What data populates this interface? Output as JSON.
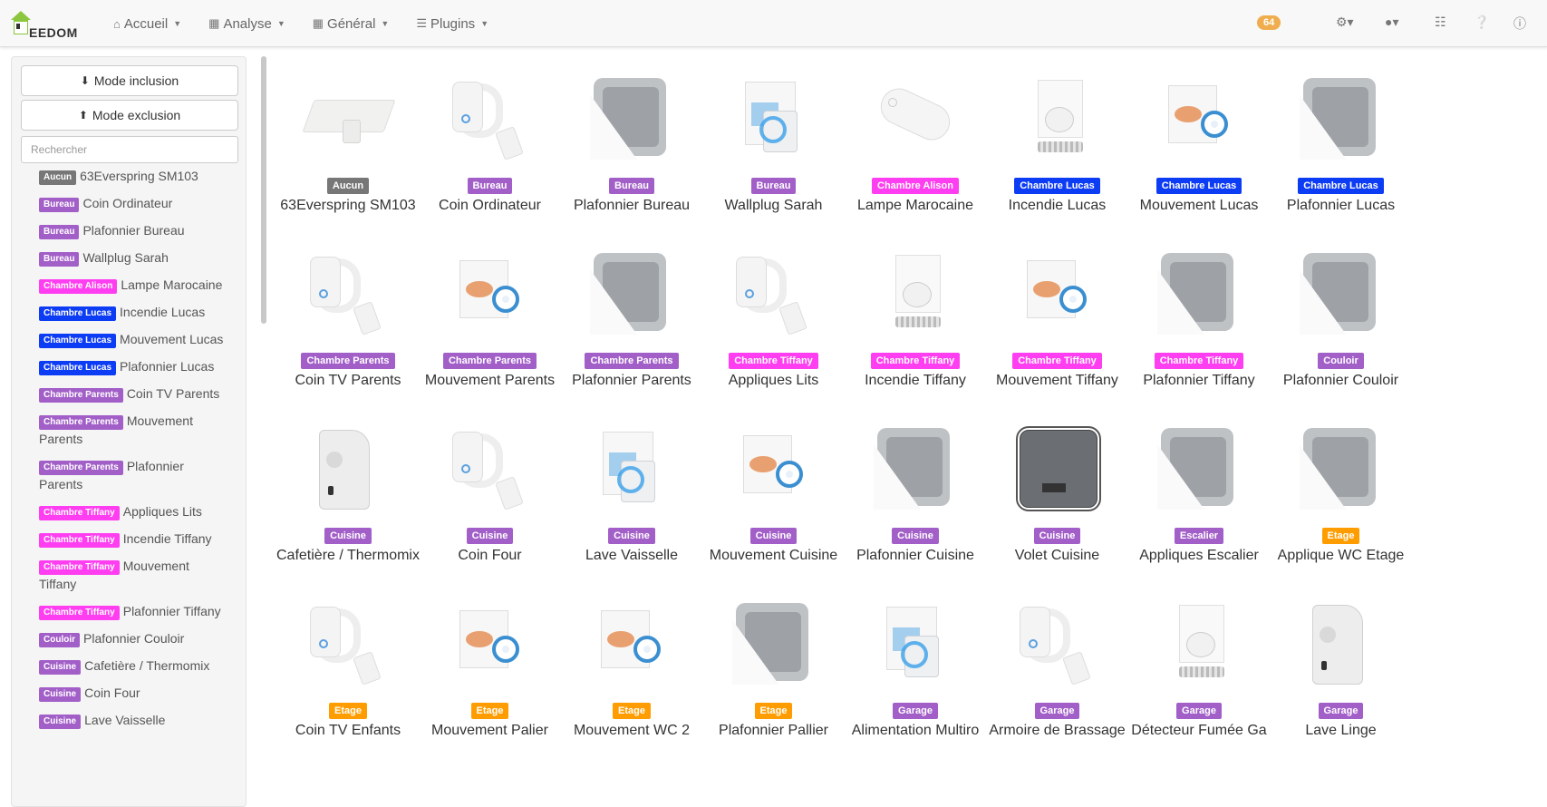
{
  "navbar": {
    "brand": "EEDOM",
    "menu": [
      {
        "label": "Accueil",
        "icon": "home-icon"
      },
      {
        "label": "Analyse",
        "icon": "grid-icon"
      },
      {
        "label": "Général",
        "icon": "grid-icon"
      },
      {
        "label": "Plugins",
        "icon": "list-icon"
      }
    ],
    "notification_count": "64",
    "right_icons": [
      "gears-icon",
      "user-icon",
      "sitemap-icon",
      "question-icon",
      "info-icon"
    ]
  },
  "sidebar": {
    "inclusion_label": "Mode inclusion",
    "exclusion_label": "Mode exclusion",
    "search_placeholder": "Rechercher",
    "items": [
      {
        "room": "Aucun",
        "name": "63Everspring SM103"
      },
      {
        "room": "Bureau",
        "name": "Coin Ordinateur"
      },
      {
        "room": "Bureau",
        "name": "Plafonnier Bureau"
      },
      {
        "room": "Bureau",
        "name": "Wallplug Sarah"
      },
      {
        "room": "Chambre Alison",
        "name": "Lampe Marocaine"
      },
      {
        "room": "Chambre Lucas",
        "name": "Incendie Lucas"
      },
      {
        "room": "Chambre Lucas",
        "name": "Mouvement Lucas"
      },
      {
        "room": "Chambre Lucas",
        "name": "Plafonnier Lucas"
      },
      {
        "room": "Chambre Parents",
        "name": "Coin TV Parents"
      },
      {
        "room": "Chambre Parents",
        "name": "Mouvement Parents"
      },
      {
        "room": "Chambre Parents",
        "name": "Plafonnier Parents"
      },
      {
        "room": "Chambre Tiffany",
        "name": "Appliques Lits"
      },
      {
        "room": "Chambre Tiffany",
        "name": "Incendie Tiffany"
      },
      {
        "room": "Chambre Tiffany",
        "name": "Mouvement Tiffany"
      },
      {
        "room": "Chambre Tiffany",
        "name": "Plafonnier Tiffany"
      },
      {
        "room": "Couloir",
        "name": "Plafonnier Couloir"
      },
      {
        "room": "Cuisine",
        "name": "Cafetière / Thermomix"
      },
      {
        "room": "Cuisine",
        "name": "Coin Four"
      },
      {
        "room": "Cuisine",
        "name": "Lave Vaisselle"
      }
    ]
  },
  "room_colors": {
    "Aucun": "#777777",
    "Bureau": "#a25fc8",
    "Chambre Alison": "#ff3df1",
    "Chambre Lucas": "#0d3cf5",
    "Chambre Parents": "#a25fc8",
    "Chambre Tiffany": "#ff3df1",
    "Couloir": "#a25fc8",
    "Cuisine": "#a25fc8",
    "Escalier": "#a25fc8",
    "Etage": "#ff9d00",
    "Garage": "#a25fc8"
  },
  "devices": [
    {
      "room": "Aucun",
      "name": "63Everspring SM103",
      "icon": "door-sensor-icon"
    },
    {
      "room": "Bureau",
      "name": "Coin Ordinateur",
      "icon": "plug-icon"
    },
    {
      "room": "Bureau",
      "name": "Plafonnier Bureau",
      "icon": "wall-switch-icon"
    },
    {
      "room": "Bureau",
      "name": "Wallplug Sarah",
      "icon": "wallplug-icon"
    },
    {
      "room": "Chambre Alison",
      "name": "Lampe Marocaine",
      "icon": "oval-module-icon"
    },
    {
      "room": "Chambre Lucas",
      "name": "Incendie Lucas",
      "icon": "smoke-sensor-icon"
    },
    {
      "room": "Chambre Lucas",
      "name": "Mouvement Lucas",
      "icon": "motion-sensor-icon"
    },
    {
      "room": "Chambre Lucas",
      "name": "Plafonnier Lucas",
      "icon": "wall-switch-icon"
    },
    {
      "room": "Chambre Parents",
      "name": "Coin TV Parents",
      "icon": "plug-icon"
    },
    {
      "room": "Chambre Parents",
      "name": "Mouvement Parents",
      "icon": "motion-sensor-icon"
    },
    {
      "room": "Chambre Parents",
      "name": "Plafonnier Parents",
      "icon": "wall-switch-icon"
    },
    {
      "room": "Chambre Tiffany",
      "name": "Appliques Lits",
      "icon": "plug-icon"
    },
    {
      "room": "Chambre Tiffany",
      "name": "Incendie Tiffany",
      "icon": "smoke-sensor-icon"
    },
    {
      "room": "Chambre Tiffany",
      "name": "Mouvement Tiffany",
      "icon": "motion-sensor-icon"
    },
    {
      "room": "Chambre Tiffany",
      "name": "Plafonnier Tiffany",
      "icon": "wall-switch-icon"
    },
    {
      "room": "Couloir",
      "name": "Plafonnier Couloir",
      "icon": "wall-switch-icon"
    },
    {
      "room": "Cuisine",
      "name": "Cafetière / Thermomix",
      "icon": "wall-plug-adapter-icon"
    },
    {
      "room": "Cuisine",
      "name": "Coin Four",
      "icon": "plug-icon"
    },
    {
      "room": "Cuisine",
      "name": "Lave Vaisselle",
      "icon": "wallplug-icon"
    },
    {
      "room": "Cuisine",
      "name": "Mouvement Cuisine",
      "icon": "motion-sensor-icon"
    },
    {
      "room": "Cuisine",
      "name": "Plafonnier Cuisine",
      "icon": "wall-switch-icon"
    },
    {
      "room": "Cuisine",
      "name": "Volet Cuisine",
      "icon": "shutter-module-icon"
    },
    {
      "room": "Escalier",
      "name": "Appliques Escalier",
      "icon": "wall-switch-icon"
    },
    {
      "room": "Etage",
      "name": "Applique WC Etage",
      "icon": "wall-switch-icon"
    },
    {
      "room": "Etage",
      "name": "Coin TV Enfants",
      "icon": "plug-icon"
    },
    {
      "room": "Etage",
      "name": "Mouvement Palier",
      "icon": "motion-sensor-icon"
    },
    {
      "room": "Etage",
      "name": "Mouvement WC 2",
      "icon": "motion-sensor-icon"
    },
    {
      "room": "Etage",
      "name": "Plafonnier Pallier",
      "icon": "wall-switch-icon"
    },
    {
      "room": "Garage",
      "name": "Alimentation Multiro",
      "icon": "wallplug-icon"
    },
    {
      "room": "Garage",
      "name": "Armoire de Brassage",
      "icon": "plug-icon"
    },
    {
      "room": "Garage",
      "name": "Détecteur Fumée Ga",
      "icon": "smoke-sensor-icon"
    },
    {
      "room": "Garage",
      "name": "Lave Linge",
      "icon": "wall-plug-adapter-icon"
    }
  ]
}
